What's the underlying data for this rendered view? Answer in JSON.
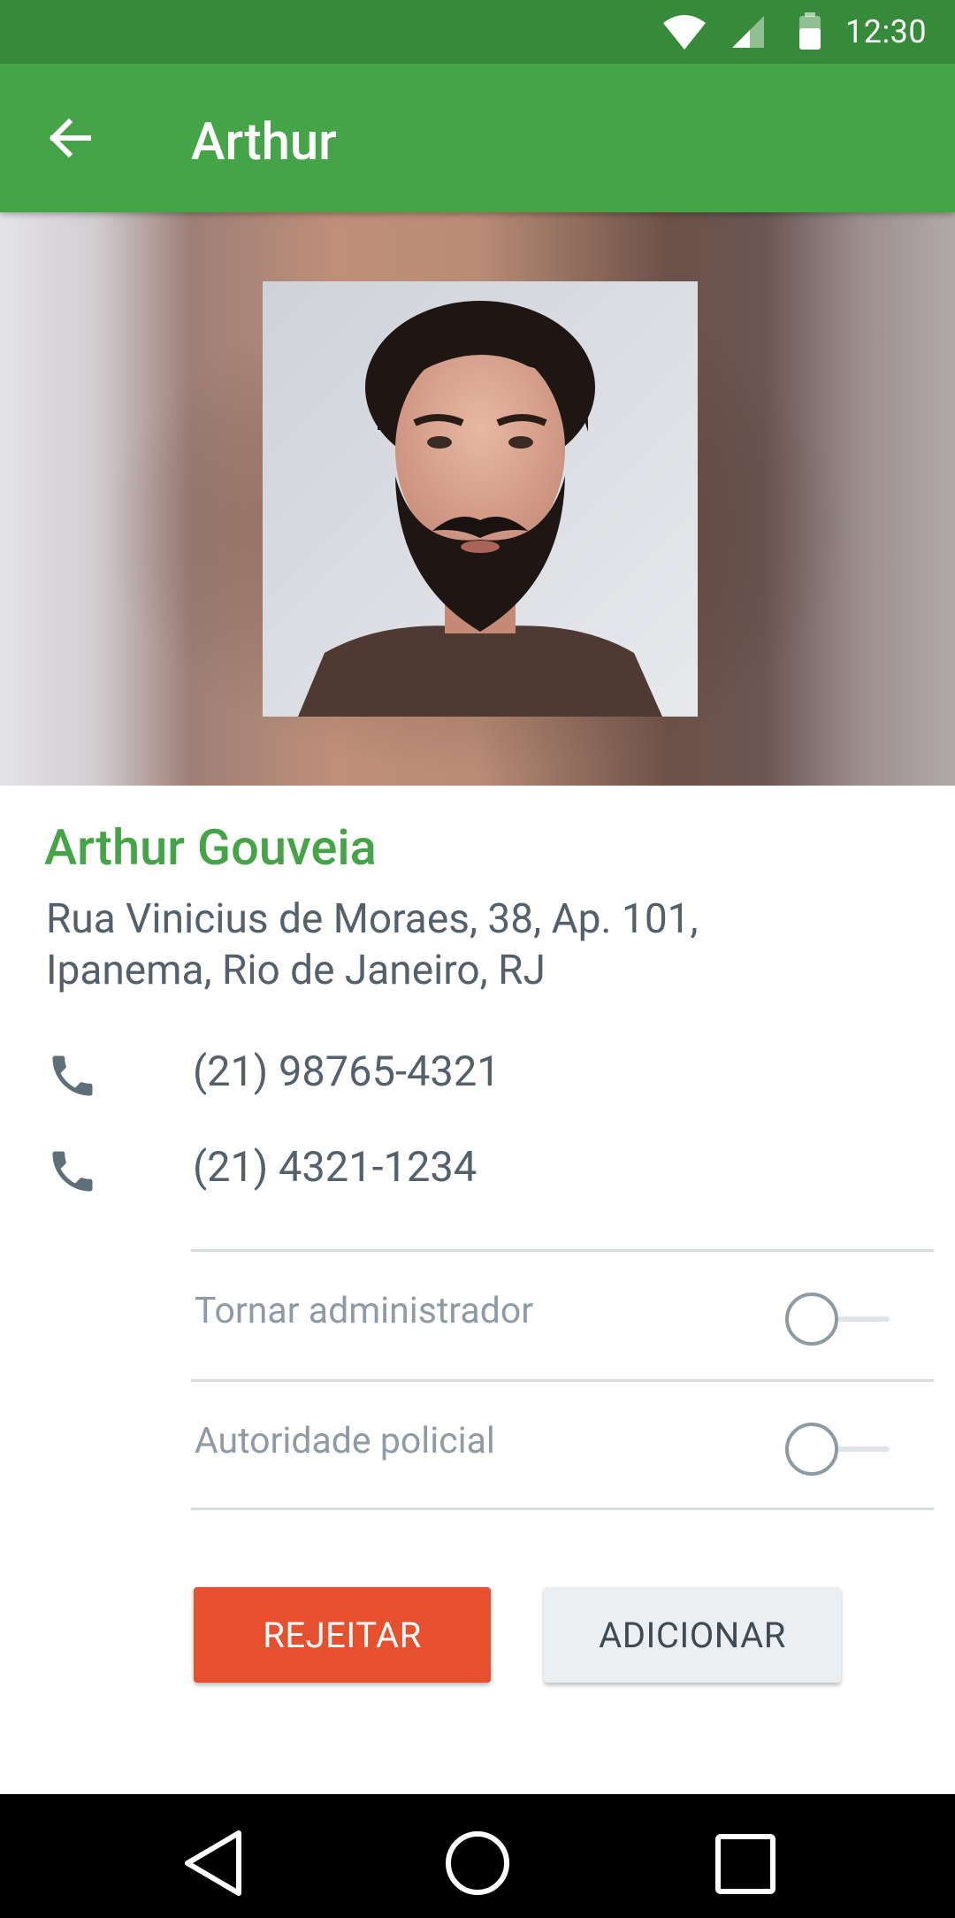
{
  "status_bar": {
    "time": "12:30",
    "icons": [
      "wifi-icon",
      "signal-icon",
      "battery-icon"
    ]
  },
  "app_bar": {
    "title": "Arthur",
    "back_icon": "arrow-left-icon"
  },
  "contact": {
    "full_name": "Arthur Gouveia",
    "address": "Rua Vinicius de Moraes, 38, Ap. 101, Ipanema, Rio de Janeiro, RJ",
    "phones": [
      {
        "number": "(21) 98765-4321",
        "icon": "phone-icon"
      },
      {
        "number": "(21) 4321-1234",
        "icon": "phone-icon"
      }
    ]
  },
  "toggles": [
    {
      "label": "Tornar administrador",
      "on": false
    },
    {
      "label": "Autoridade policial",
      "on": false
    }
  ],
  "actions": {
    "reject_label": "REJEITAR",
    "add_label": "ADICIONAR"
  },
  "colors": {
    "status_bar": "#388a3b",
    "app_bar": "#45a348",
    "accent_green": "#45a348",
    "reject": "#e6502e",
    "add": "#eceff1",
    "text": "#54616b",
    "muted_text": "#8e9ba4"
  },
  "nav_bar": {
    "icons": [
      "nav-back-icon",
      "nav-home-icon",
      "nav-recents-icon"
    ]
  }
}
